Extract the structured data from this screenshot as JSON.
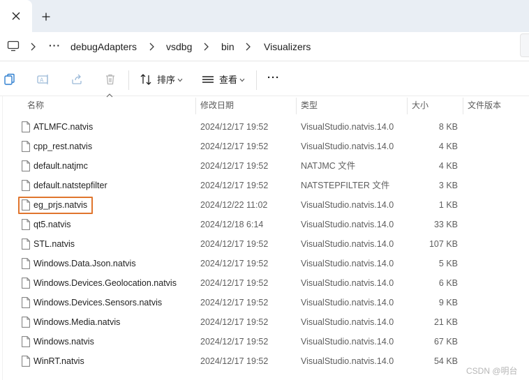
{
  "tab": {
    "close_glyph": "✕",
    "newtab_glyph": "+"
  },
  "address": {
    "icon": "computer-icon",
    "overflow": "···",
    "crumbs": [
      "debugAdapters",
      "vsdbg",
      "bin",
      "Visualizers"
    ]
  },
  "toolbar": {
    "icons": [
      "copy-icon",
      "rename-icon",
      "share-icon",
      "delete-icon"
    ],
    "sort_label": "排序",
    "view_label": "查看",
    "more_glyph": "···"
  },
  "columns": {
    "name": "名称",
    "modified": "修改日期",
    "type": "类型",
    "size": "大小",
    "version": "文件版本"
  },
  "files": [
    {
      "name": "ATLMFC.natvis",
      "date": "2024/12/17 19:52",
      "type": "VisualStudio.natvis.14.0",
      "size": "8 KB"
    },
    {
      "name": "cpp_rest.natvis",
      "date": "2024/12/17 19:52",
      "type": "VisualStudio.natvis.14.0",
      "size": "4 KB"
    },
    {
      "name": "default.natjmc",
      "date": "2024/12/17 19:52",
      "type": "NATJMC 文件",
      "size": "4 KB"
    },
    {
      "name": "default.natstepfilter",
      "date": "2024/12/17 19:52",
      "type": "NATSTEPFILTER 文件",
      "size": "3 KB"
    },
    {
      "name": "eg_prjs.natvis",
      "date": "2024/12/22 11:02",
      "type": "VisualStudio.natvis.14.0",
      "size": "1 KB",
      "highlighted": true
    },
    {
      "name": "qt5.natvis",
      "date": "2024/12/18 6:14",
      "type": "VisualStudio.natvis.14.0",
      "size": "33 KB"
    },
    {
      "name": "STL.natvis",
      "date": "2024/12/17 19:52",
      "type": "VisualStudio.natvis.14.0",
      "size": "107 KB"
    },
    {
      "name": "Windows.Data.Json.natvis",
      "date": "2024/12/17 19:52",
      "type": "VisualStudio.natvis.14.0",
      "size": "5 KB"
    },
    {
      "name": "Windows.Devices.Geolocation.natvis",
      "date": "2024/12/17 19:52",
      "type": "VisualStudio.natvis.14.0",
      "size": "6 KB"
    },
    {
      "name": "Windows.Devices.Sensors.natvis",
      "date": "2024/12/17 19:52",
      "type": "VisualStudio.natvis.14.0",
      "size": "9 KB"
    },
    {
      "name": "Windows.Media.natvis",
      "date": "2024/12/17 19:52",
      "type": "VisualStudio.natvis.14.0",
      "size": "21 KB"
    },
    {
      "name": "Windows.natvis",
      "date": "2024/12/17 19:52",
      "type": "VisualStudio.natvis.14.0",
      "size": "67 KB"
    },
    {
      "name": "WinRT.natvis",
      "date": "2024/12/17 19:52",
      "type": "VisualStudio.natvis.14.0",
      "size": "54 KB"
    }
  ],
  "highlight_color": "#e0752d",
  "watermark": "CSDN @明台"
}
